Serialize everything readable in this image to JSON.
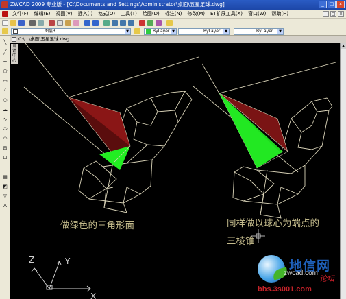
{
  "window": {
    "title": "ZWCAD 2009 专业版 - [C:\\Documents and Settings\\Administrator\\桌面\\五星足球.dwg]",
    "controls": [
      "_",
      "□",
      "×"
    ]
  },
  "menubar": {
    "items": [
      "文件(F)",
      "编辑(E)",
      "视图(V)",
      "插入(I)",
      "格式(O)",
      "工具(T)",
      "绘图(D)",
      "标注(N)",
      "修改(M)",
      "ET扩展工具(X)",
      "窗口(W)",
      "帮助(H)"
    ]
  },
  "properties_bar": {
    "layer": "图层3",
    "color": "ByLayer",
    "linetype": "ByLayer",
    "lineweight": "ByLayer",
    "color_swatch": "#2ecc40"
  },
  "document": {
    "tab_title": "C:\\...\\桌面\\五星足球.dwg",
    "side_panel_label": "设计中心"
  },
  "captions": {
    "left": "做绿色的三角形面",
    "right_line1": "同样做以球心为端点的",
    "right_line2": "三棱锥"
  },
  "ucs": {
    "z": "Z",
    "y": "Y",
    "x": "X"
  },
  "watermark": {
    "site_cn": "地信网",
    "site_en": "zwcad.com",
    "forum": "论坛",
    "url": "bbs.3s001.com"
  },
  "colors": {
    "canvas_bg": "#000000",
    "wire": "#d9d3b8",
    "red_face": "#7a1414",
    "green_face": "#22ee22",
    "caption": "#c2b98a"
  }
}
